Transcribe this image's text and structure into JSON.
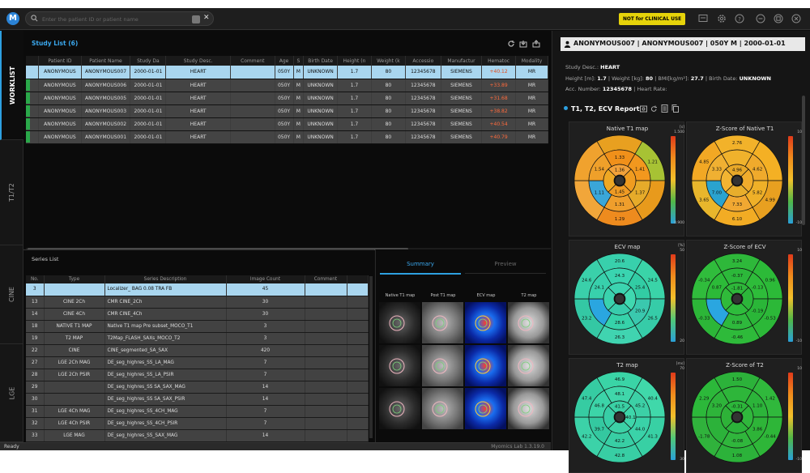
{
  "topbar": {
    "search_placeholder": "Enter the patient ID or patient name",
    "badge": "NOT for CLINICAL USE"
  },
  "side_tabs": [
    "WORKLIST",
    "T1/T2",
    "CINE",
    "LGE"
  ],
  "study_list": {
    "title": "Study List  (6)",
    "columns": [
      "",
      "Patient ID",
      "Patient Name",
      "Study Da",
      "Study Desc.",
      "Comment",
      "Age",
      "S",
      "Birth Date",
      "Height (n",
      "Weight (k",
      "Accessio",
      "Manufactur",
      "Hematoc",
      "Modality"
    ],
    "rows": [
      [
        "",
        "ANONYMOUS",
        "ANONYMOUS007",
        "2000-01-01",
        "HEART",
        "",
        "050Y",
        "M",
        "UNKNOWN",
        "1.7",
        "80",
        "12345678",
        "SIEMENS",
        "+40.12",
        "MR"
      ],
      [
        "",
        "ANONYMOUS",
        "ANONYMOUS006",
        "2000-01-01",
        "HEART",
        "",
        "050Y",
        "M",
        "UNKNOWN",
        "1.7",
        "80",
        "12345678",
        "SIEMENS",
        "+33.89",
        "MR"
      ],
      [
        "",
        "ANONYMOUS",
        "ANONYMOUS005",
        "2000-01-01",
        "HEART",
        "",
        "050Y",
        "M",
        "UNKNOWN",
        "1.7",
        "80",
        "12345678",
        "SIEMENS",
        "+31.68",
        "MR"
      ],
      [
        "",
        "ANONYMOUS",
        "ANONYMOUS003",
        "2000-01-01",
        "HEART",
        "",
        "050Y",
        "M",
        "UNKNOWN",
        "1.7",
        "80",
        "12345678",
        "SIEMENS",
        "+38.82",
        "MR"
      ],
      [
        "",
        "ANONYMOUS",
        "ANONYMOUS002",
        "2000-01-01",
        "HEART",
        "",
        "050Y",
        "M",
        "UNKNOWN",
        "1.7",
        "80",
        "12345678",
        "SIEMENS",
        "+40.54",
        "MR"
      ],
      [
        "",
        "ANONYMOUS",
        "ANONYMOUS001",
        "2000-01-01",
        "HEART",
        "",
        "050Y",
        "M",
        "UNKNOWN",
        "1.7",
        "80",
        "12345678",
        "SIEMENS",
        "+40.79",
        "MR"
      ]
    ]
  },
  "series_list": {
    "title": "Series List",
    "columns": [
      "No.",
      "Type",
      "Series Description",
      "Image Count",
      "Comment",
      ""
    ],
    "rows": [
      [
        "3",
        "",
        "Localizer_ BAG 0.08 TRA FB",
        "45",
        "",
        ""
      ],
      [
        "13",
        "CINE 2Ch",
        "CMR CINE_2Ch",
        "30",
        "",
        ""
      ],
      [
        "14",
        "CINE 4Ch",
        "CMR CINE_4Ch",
        "30",
        "",
        ""
      ],
      [
        "18",
        "NATIVE T1 MAP",
        "Native T1 map Pre subset_MOCO_T1",
        "3",
        "",
        ""
      ],
      [
        "19",
        "T2 MAP",
        "T2Map_FLASH_SAXs_MOCO_T2",
        "3",
        "",
        ""
      ],
      [
        "22",
        "CINE",
        "CINE_segmented_SA_SAX",
        "420",
        "",
        ""
      ],
      [
        "27",
        "LGE 2Ch MAG",
        "DE_seg_highres_SS_LA_MAG",
        "7",
        "",
        ""
      ],
      [
        "28",
        "LGE 2Ch PSIR",
        "DE_seg_highres_SS_LA_PSIR",
        "7",
        "",
        ""
      ],
      [
        "29",
        "",
        "DE_seg_highres_SS SA_SAX_MAG",
        "14",
        "",
        ""
      ],
      [
        "30",
        "",
        "DE_seg_highres_SS SA_SAX_PSIR",
        "14",
        "",
        ""
      ],
      [
        "31",
        "LGE 4Ch MAG",
        "DE_seg_highres_SS_4CH_MAG",
        "7",
        "",
        ""
      ],
      [
        "32",
        "LGE 4Ch PSIR",
        "DE_seg_highres_SS_4CH_PSIR",
        "7",
        "",
        ""
      ],
      [
        "33",
        "LGE MAG",
        "DE_seg_highres_SS_SAX_MAG",
        "14",
        "",
        ""
      ]
    ]
  },
  "summary": {
    "tabs": [
      "Summary",
      "Preview"
    ],
    "map_titles": [
      "Native T1 map",
      "Post T1 map",
      "ECV map",
      "T2 map"
    ]
  },
  "status": {
    "left": "Ready",
    "version": "Myomics Lab 1.3.19.0"
  },
  "patient": {
    "header": "ANONYMOUS007 | ANONYMOUS007 | 050Y M | 2000-01-01",
    "study_desc_label": "Study Desc.:",
    "study_desc": "HEART",
    "height_label": "Height [m]:",
    "height": "1.7",
    "weight_label": "| Weight [kg]:",
    "weight": "80",
    "bmi_label": "| BMI[kg/m²]:",
    "bmi": "27.7",
    "birth_label": "| Birth Date:",
    "birth": "UNKNOWN",
    "acc_label": "Acc. Number:",
    "acc": "12345678",
    "hr_label": "| Heart Rate:"
  },
  "report": {
    "title": "T1, T2, ECV Report",
    "panels": [
      {
        "title": "Native T1 map",
        "unit": "[s]",
        "max": "1.500",
        "min": "0.900",
        "colors": [
          "#e8a020",
          "#a7c234",
          "#e89a1c",
          "#ee8b1e",
          "#f1a63a",
          "#f0a22e",
          "#f0901a",
          "#f2981e",
          "#e6ab2a",
          "#ef9e2c",
          "#3aa6d8",
          "#efa02a",
          "#f2a13a",
          "#f09c20",
          "#ee9a24",
          "#eea824"
        ],
        "values": [
          "",
          "1.21",
          "",
          "1.29",
          "",
          "",
          "1.33",
          "1.41",
          "1.37",
          "1.31",
          "1.11",
          "1.54",
          "1.36",
          "",
          "1.45",
          ""
        ]
      },
      {
        "title": "Z-Score of Native T1",
        "unit": "",
        "max": "10",
        "min": "-10",
        "colors": [
          "#f2b22a",
          "#f4b024",
          "#e8a020",
          "#f2ac24",
          "#e8b62c",
          "#f2a824",
          "#f0b22c",
          "#f0aa2c",
          "#efb028",
          "#f1a832",
          "#2aa3cf",
          "#f0b032",
          "#e8a828",
          "#f0ac2c",
          "#e8ae2c",
          "#f2b432"
        ],
        "values": [
          "2.76",
          "",
          "4.99",
          "6.10",
          "3.65",
          "4.85",
          "",
          "4.62",
          "5.82",
          "7.33",
          "7.00",
          "3.33",
          "4.96",
          "",
          "",
          ""
        ]
      },
      {
        "title": "ECV map",
        "unit": "[%]",
        "max": "50",
        "min": "20",
        "colors": [
          "#38d0ac",
          "#3ad4a8",
          "#36cca8",
          "#40d4b0",
          "#34c8a4",
          "#3ad0aa",
          "#3ad4b0",
          "#32cca4",
          "#3ac8ae",
          "#36d2aa",
          "#2aa6e0",
          "#38d0ac",
          "#3cd4b0",
          "#40d8b0",
          "#38ccac",
          "#3ad2ae"
        ],
        "values": [
          "20.6",
          "24.5",
          "26.5",
          "26.3",
          "23.2",
          "24.6",
          "24.3",
          "25.4",
          "20.9",
          "28.6",
          "",
          "24.1",
          "",
          "",
          "",
          ""
        ]
      },
      {
        "title": "Z-Score of ECV",
        "unit": "",
        "max": "10",
        "min": "-10",
        "colors": [
          "#2eb83a",
          "#2cba38",
          "#2cb838",
          "#2eba3a",
          "#2cb638",
          "#30bc3c",
          "#2cb83a",
          "#2ebc3a",
          "#2ab638",
          "#2eb83c",
          "#2aa6e0",
          "#2cba38",
          "#2eb83a",
          "#2cb63a",
          "#2ebc3c",
          "#30ba3a"
        ],
        "values": [
          "3.24",
          "0.96",
          "-0.53",
          "-0.46",
          "-0.33",
          "-0.34",
          "-0.37",
          "-0.13",
          "-0.19",
          "0.89",
          "",
          "0.87",
          "-1.81",
          "",
          "",
          ""
        ]
      },
      {
        "title": "T2 map",
        "unit": "[ms]",
        "max": "70",
        "min": "30",
        "colors": [
          "#3ad4a6",
          "#40d8aa",
          "#38d0a4",
          "#38cea4",
          "#3cd2a8",
          "#36cca2",
          "#40d6aa",
          "#3cd0a6",
          "#3ad2a8",
          "#38cea4",
          "#34c8a0",
          "#3cd4a8",
          "#3ad0a4",
          "#3ed6aa",
          "#3cd2a6",
          "#38cea6"
        ],
        "values": [
          "46.9",
          "40.4",
          "41.3",
          "42.8",
          "42.2",
          "47.4",
          "48.1",
          "45.2",
          "44.0",
          "42.2",
          "39.7",
          "46.8",
          "41.5",
          "40.1",
          "",
          ""
        ]
      },
      {
        "title": "Z-Score of T2",
        "unit": "",
        "max": "10",
        "min": "-10",
        "colors": [
          "#2cb23a",
          "#30b83c",
          "#2eb638",
          "#2cb23a",
          "#30b23c",
          "#2cb83a",
          "#2eb63a",
          "#2cb43a",
          "#2eb438",
          "#30b63c",
          "#2cb23a",
          "#2eb43a",
          "#2cb63a",
          "#30b83c",
          "#2cb43a",
          "#2eb238"
        ],
        "values": [
          "1.50",
          "1.42",
          "-0.44",
          "1.08",
          "-1.78",
          "2.29",
          "",
          "1.10",
          "3.86",
          "-0.08",
          "",
          "3.20",
          "-0.31",
          "",
          "",
          ""
        ]
      }
    ]
  },
  "colors": {
    "accent": "#2da0e0",
    "badge": "#e6d30a",
    "selected_row": "#a9d6ef",
    "hematocrit": "#ff6b3d"
  }
}
